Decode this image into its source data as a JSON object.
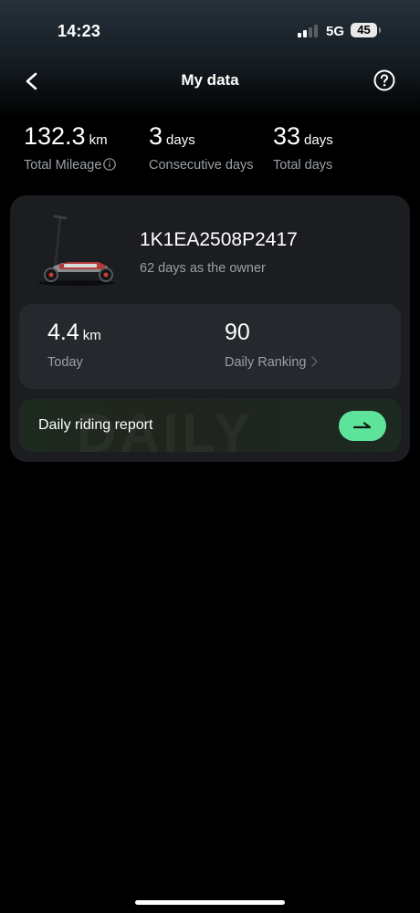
{
  "status_bar": {
    "time": "14:23",
    "network": "5G",
    "battery": "45"
  },
  "nav": {
    "title": "My data"
  },
  "stats": [
    {
      "value": "132.3",
      "unit": "km",
      "label": "Total Mileage"
    },
    {
      "value": "3",
      "unit": "days",
      "label": "Consecutive days"
    },
    {
      "value": "33",
      "unit": "days",
      "label": "Total days"
    }
  ],
  "vehicle": {
    "id": "1K1EA2508P2417",
    "ownership": "62 days as the owner"
  },
  "daily": {
    "today": {
      "value": "4.4",
      "unit": "km",
      "label": "Today"
    },
    "ranking": {
      "value": "90",
      "label": "Daily Ranking"
    }
  },
  "report": {
    "label": "Daily riding report",
    "watermark": "DAILY"
  },
  "colors": {
    "accent": "#5ee39a",
    "card": "#1b1d20",
    "muted_text": "#9aa0a6"
  }
}
